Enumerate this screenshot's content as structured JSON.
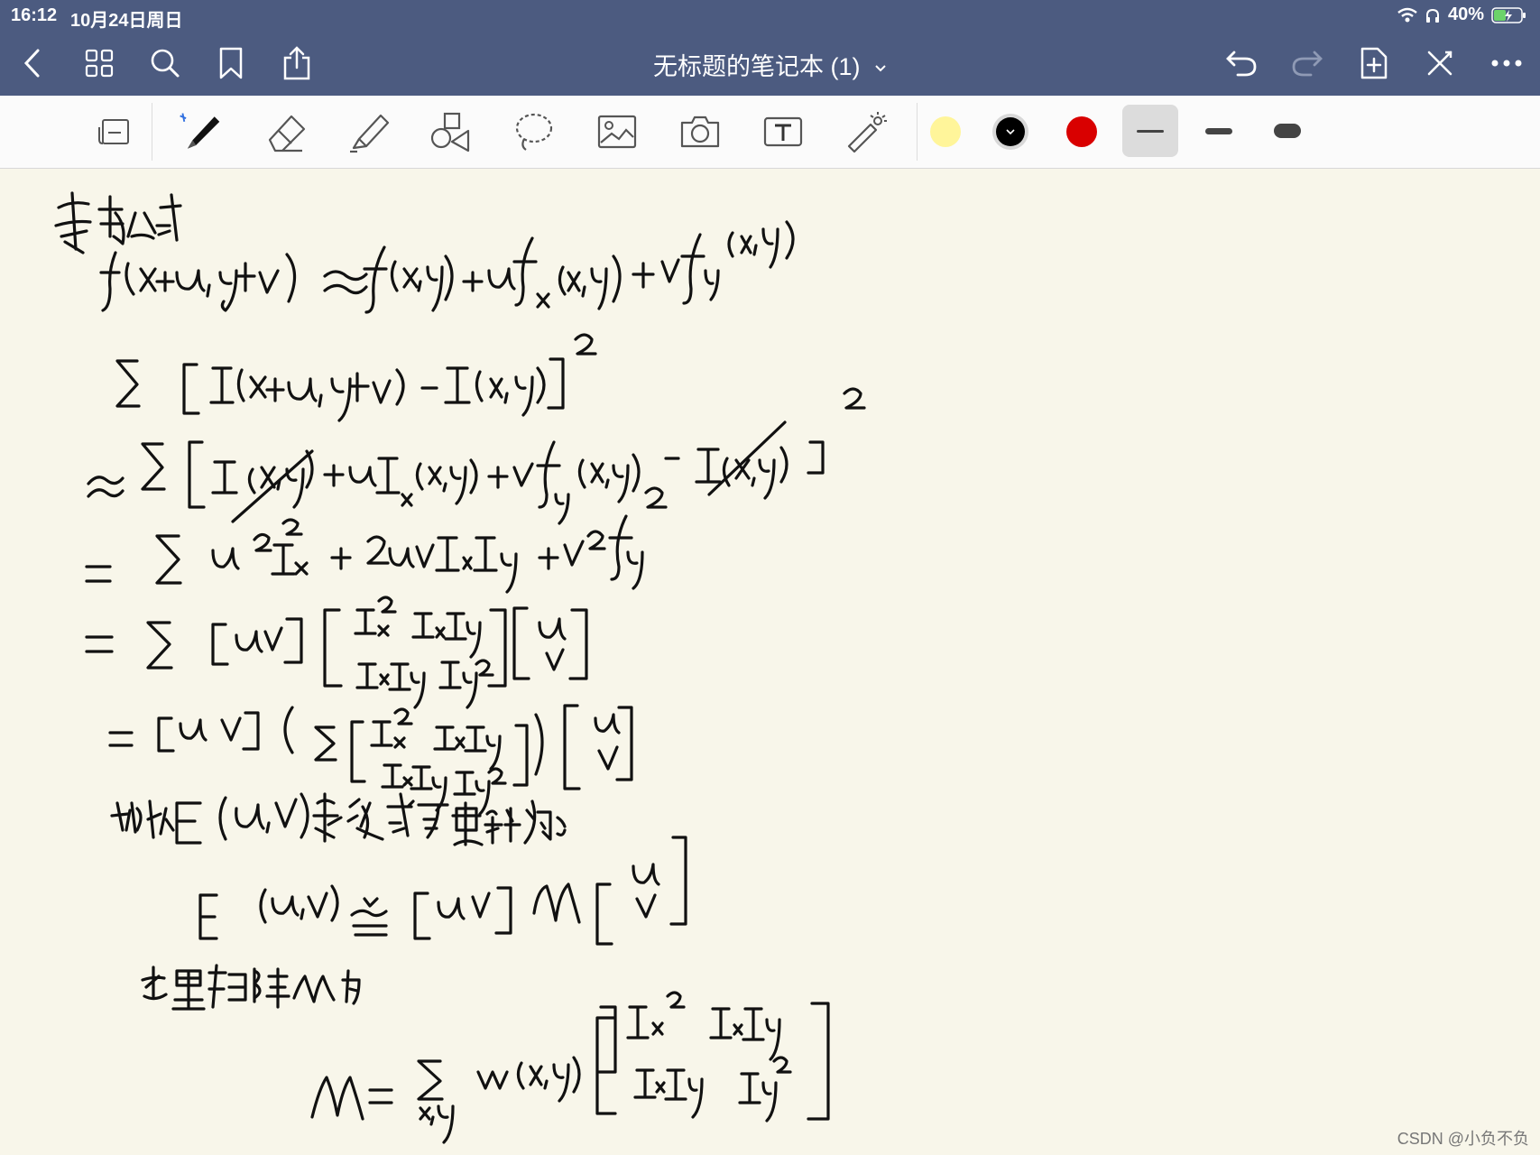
{
  "status_bar": {
    "time": "16:12",
    "date": "10月24日周日",
    "battery_percent": "40%"
  },
  "nav": {
    "title": "无标题的笔记本 (1)",
    "icons": [
      "back-icon",
      "grid-icon",
      "search-icon",
      "bookmark-icon",
      "share-icon",
      "undo-icon",
      "redo-icon",
      "add-page-icon",
      "close-tools-icon",
      "more-icon"
    ]
  },
  "toolbar": {
    "tools": [
      "page-rotate-icon",
      "pen-icon",
      "eraser-icon",
      "highlighter-icon",
      "shapes-icon",
      "lasso-icon",
      "image-icon",
      "camera-icon",
      "text-icon",
      "laser-pointer-icon"
    ],
    "colors": [
      "#fff59a",
      "#000000",
      "#d90000"
    ],
    "selected_color": "#000000",
    "stroke_widths": [
      "thin",
      "medium",
      "thick"
    ],
    "selected_width": "thin"
  },
  "watermark": "CSDN @小负不负"
}
